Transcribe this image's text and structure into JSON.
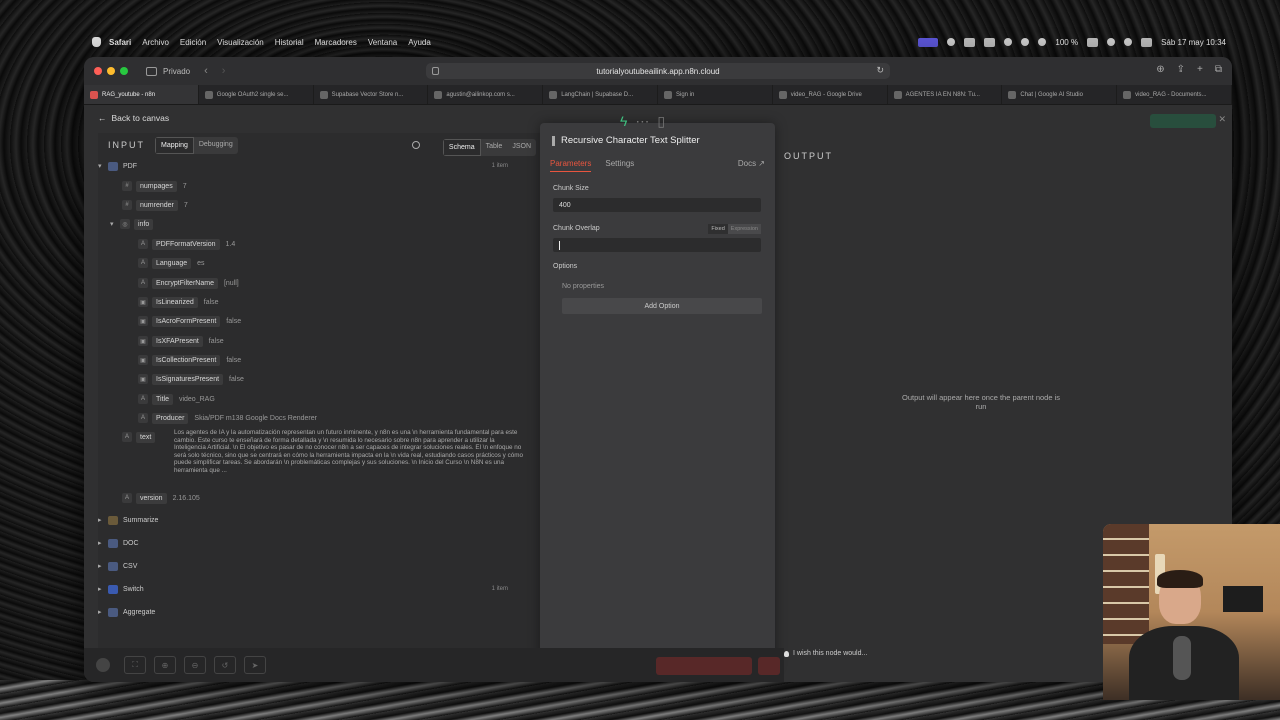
{
  "menubar": {
    "items": [
      "Safari",
      "Archivo",
      "Edición",
      "Visualización",
      "Historial",
      "Marcadores",
      "Ventana",
      "Ayuda"
    ],
    "battery": "100 %",
    "datetime": "Sáb 17 may  10:34"
  },
  "browser": {
    "private_label": "Privado",
    "url": "tutorialyoutubeailink.app.n8n.cloud",
    "tabs": [
      "RAG_youtube - n8n",
      "Google OAuth2 single se...",
      "Supabase Vector Store n...",
      "agustin@ailinkop.com s...",
      "LangChain | Supabase D...",
      "Sign in",
      "video_RAG - Google Drive",
      "AGENTES IA EN N8N: Tu...",
      "Chat | Google AI Studio",
      "video_RAG - Documents..."
    ]
  },
  "app": {
    "back_label": "Back to canvas"
  },
  "input_panel": {
    "title": "INPUT",
    "mode_tabs": [
      "Mapping",
      "Debugging"
    ],
    "view_tabs": [
      "Schema",
      "Table",
      "JSON"
    ],
    "pdf_node": "PDF",
    "pdf_count": "1 item",
    "fields": [
      {
        "key": "numpages",
        "value": "7"
      },
      {
        "key": "numrender",
        "value": "7"
      }
    ],
    "info_key": "info",
    "info_fields": [
      {
        "key": "PDFFormatVersion",
        "value": "1.4"
      },
      {
        "key": "Language",
        "value": "es"
      },
      {
        "key": "EncryptFilterName",
        "value": "[null]"
      },
      {
        "key": "IsLinearized",
        "value": "false"
      },
      {
        "key": "IsAcroFormPresent",
        "value": "false"
      },
      {
        "key": "IsXFAPresent",
        "value": "false"
      },
      {
        "key": "IsCollectionPresent",
        "value": "false"
      },
      {
        "key": "IsSignaturesPresent",
        "value": "false"
      },
      {
        "key": "Title",
        "value": "video_RAG"
      },
      {
        "key": "Producer",
        "value": "Skia/PDF m138 Google Docs Renderer"
      }
    ],
    "text_key": "text",
    "text_value": "Los agentes de IA y la automatización representan un futuro inminente, y n8n es una \\n herramienta fundamental para este cambio. Este curso te enseñará de forma detallada y \\n resumida lo necesario sobre n8n para aprender a utilizar la Inteligencia Artificial. \\n El objetivo es pasar de no conocer n8n a ser capaces de integrar soluciones reales. El \\n enfoque no será solo técnico, sino que se centrará en cómo la herramienta impacta en la \\n vida real, estudiando casos prácticos y cómo puede simplificar tareas. Se abordarán \\n problemáticas complejas y sus soluciones. \\n Inicio del Curso \\n N8N es una herramienta que ...",
    "version_key": "version",
    "version_value": "2.16.105",
    "other_nodes": [
      {
        "name": "Summarize",
        "count": ""
      },
      {
        "name": "DOC",
        "count": ""
      },
      {
        "name": "CSV",
        "count": ""
      },
      {
        "name": "Switch",
        "count": "1 item"
      },
      {
        "name": "Aggregate",
        "count": ""
      }
    ]
  },
  "node_panel": {
    "title": "Recursive Character Text Splitter",
    "tabs": [
      "Parameters",
      "Settings"
    ],
    "docs_label": "Docs ↗",
    "chunk_size_label": "Chunk Size",
    "chunk_size_value": "400",
    "chunk_overlap_label": "Chunk Overlap",
    "fixed_label": "Fixed",
    "expression_label": "Expression",
    "options_label": "Options",
    "no_properties": "No properties",
    "add_option": "Add Option"
  },
  "output_panel": {
    "title": "OUTPUT",
    "message": "Output will appear here once the parent node is run"
  },
  "hint": "I wish this node would...",
  "colors": {
    "accent_red": "#e8553f",
    "n8n_green": "#3fbf7f"
  }
}
